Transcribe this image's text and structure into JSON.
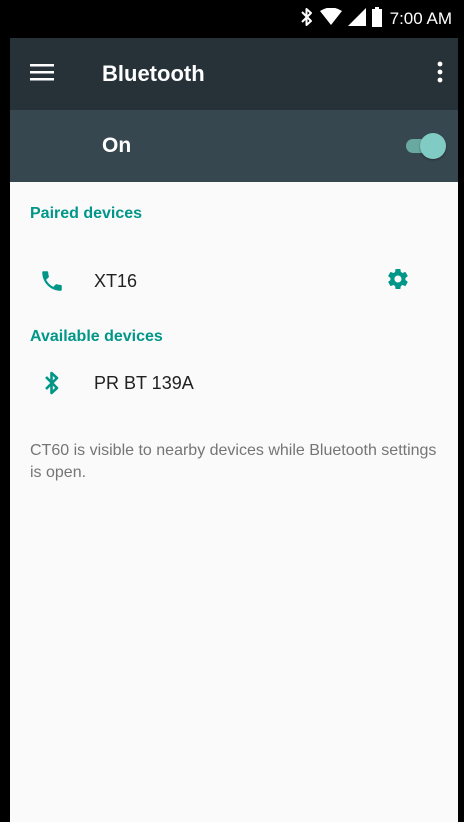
{
  "status_bar": {
    "time": "7:00 AM",
    "icons": [
      "bluetooth-icon",
      "wifi-icon",
      "signal-icon",
      "battery-icon"
    ]
  },
  "toolbar": {
    "title": "Bluetooth",
    "menu_icon": "menu-icon",
    "overflow_icon": "more-vert-icon"
  },
  "master_switch": {
    "label": "On",
    "checked": true
  },
  "paired": {
    "header": "Paired devices",
    "devices": [
      {
        "name": "XT16",
        "icon": "phone-icon",
        "settings_icon": "gear-icon"
      }
    ]
  },
  "available": {
    "header": "Available devices",
    "devices": [
      {
        "name": "PR BT 139A",
        "icon": "bluetooth-icon"
      }
    ]
  },
  "footer": "CT60 is visible to nearby devices while Bluetooth settings is open.",
  "colors": {
    "accent": "#009688",
    "toolbar": "#263238",
    "switch_bar": "#37474f",
    "toggle_on": "#80cbc4"
  }
}
